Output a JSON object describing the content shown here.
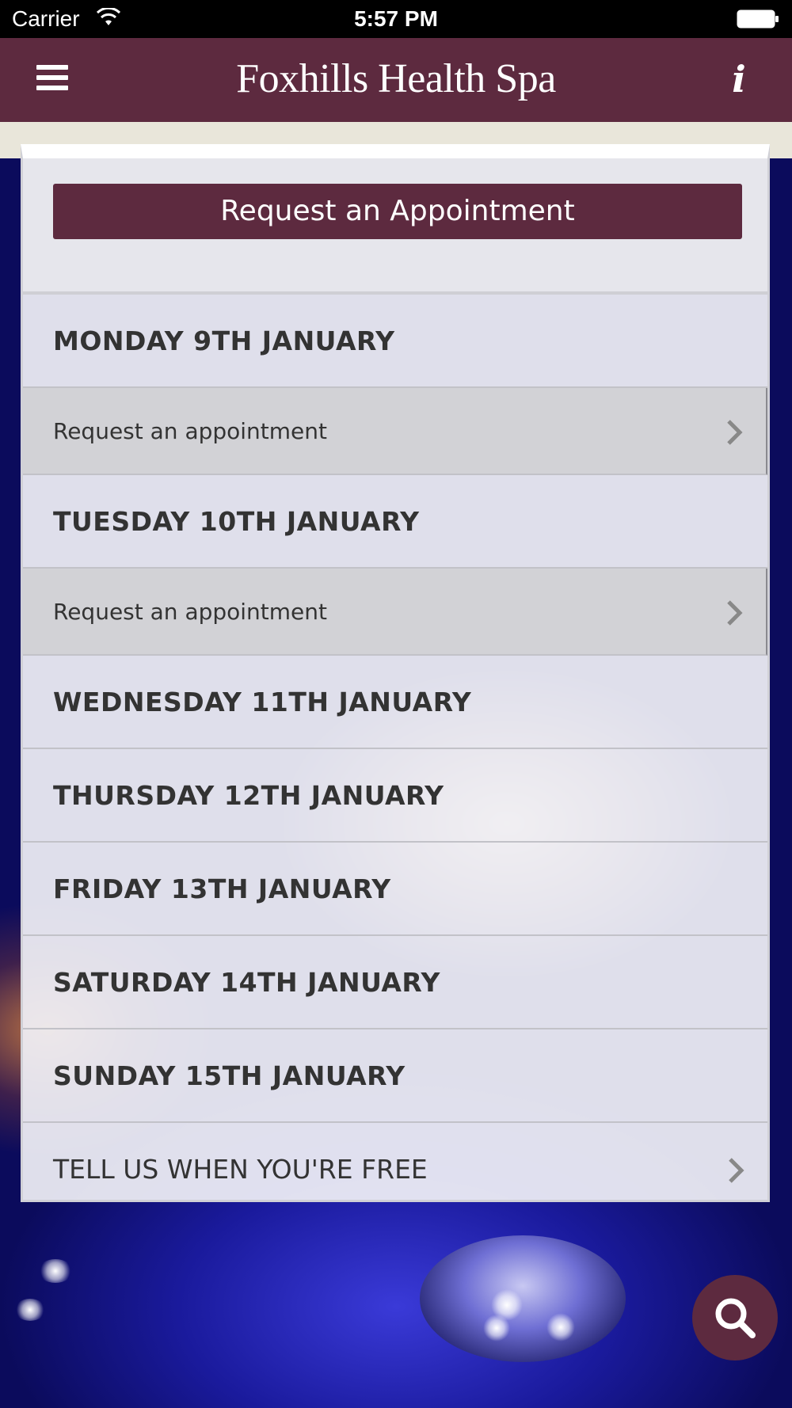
{
  "status_bar": {
    "carrier": "Carrier",
    "time": "5:57 PM",
    "icons": [
      "wifi-icon",
      "battery-icon"
    ]
  },
  "nav": {
    "title": "Foxhills Health Spa",
    "menu_icon": "menu-icon",
    "info_icon": "info-icon",
    "info_glyph": "i"
  },
  "card": {
    "request_button_label": "Request an Appointment",
    "days": [
      {
        "label": "MONDAY 9TH JANUARY",
        "appointment_label": "Request an appointment"
      },
      {
        "label": "TUESDAY 10TH JANUARY",
        "appointment_label": "Request an appointment"
      },
      {
        "label": "WEDNESDAY 11TH JANUARY"
      },
      {
        "label": "THURSDAY 12TH JANUARY"
      },
      {
        "label": "FRIDAY 13TH JANUARY"
      },
      {
        "label": "SATURDAY 14TH JANUARY"
      },
      {
        "label": "SUNDAY 15TH JANUARY"
      }
    ],
    "free_label": "TELL US WHEN YOU'RE FREE"
  },
  "search_fab_icon": "search-icon",
  "colors": {
    "brand": "#5d2a3f",
    "status_bar": "#000000",
    "beige": "#e9e6da"
  }
}
